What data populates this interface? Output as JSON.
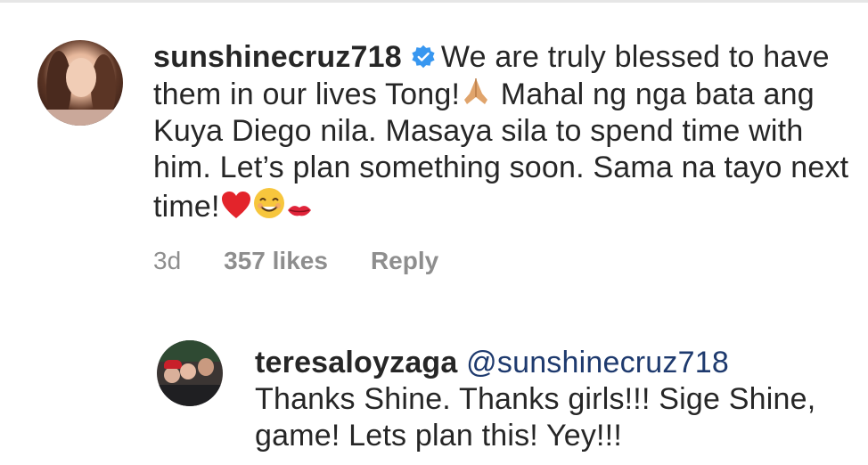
{
  "comment": {
    "username": "sunshinecruz718",
    "verified": true,
    "text_part1": "We are truly blessed to have them in our lives Tong!",
    "text_part2": " Mahal ng nga bata ang Kuya Diego nila. Masaya sila to spend time with him. Let’s plan something soon. Sama na tayo next time!",
    "emojis": [
      "folded-hands",
      "red-heart",
      "smiling-face",
      "kiss-mark"
    ],
    "time": "3d",
    "likes": "357 likes",
    "reply_label": "Reply"
  },
  "reply": {
    "username": "teresaloyzaga",
    "mention": "@sunshinecruz718",
    "text": "Thanks Shine. Thanks girls!!! Sige Shine, game! Lets plan this! Yey!!!"
  },
  "colors": {
    "text": "#262626",
    "meta": "#8e8e8e",
    "mention": "#1e3a6e",
    "verified": "#3897f0"
  }
}
